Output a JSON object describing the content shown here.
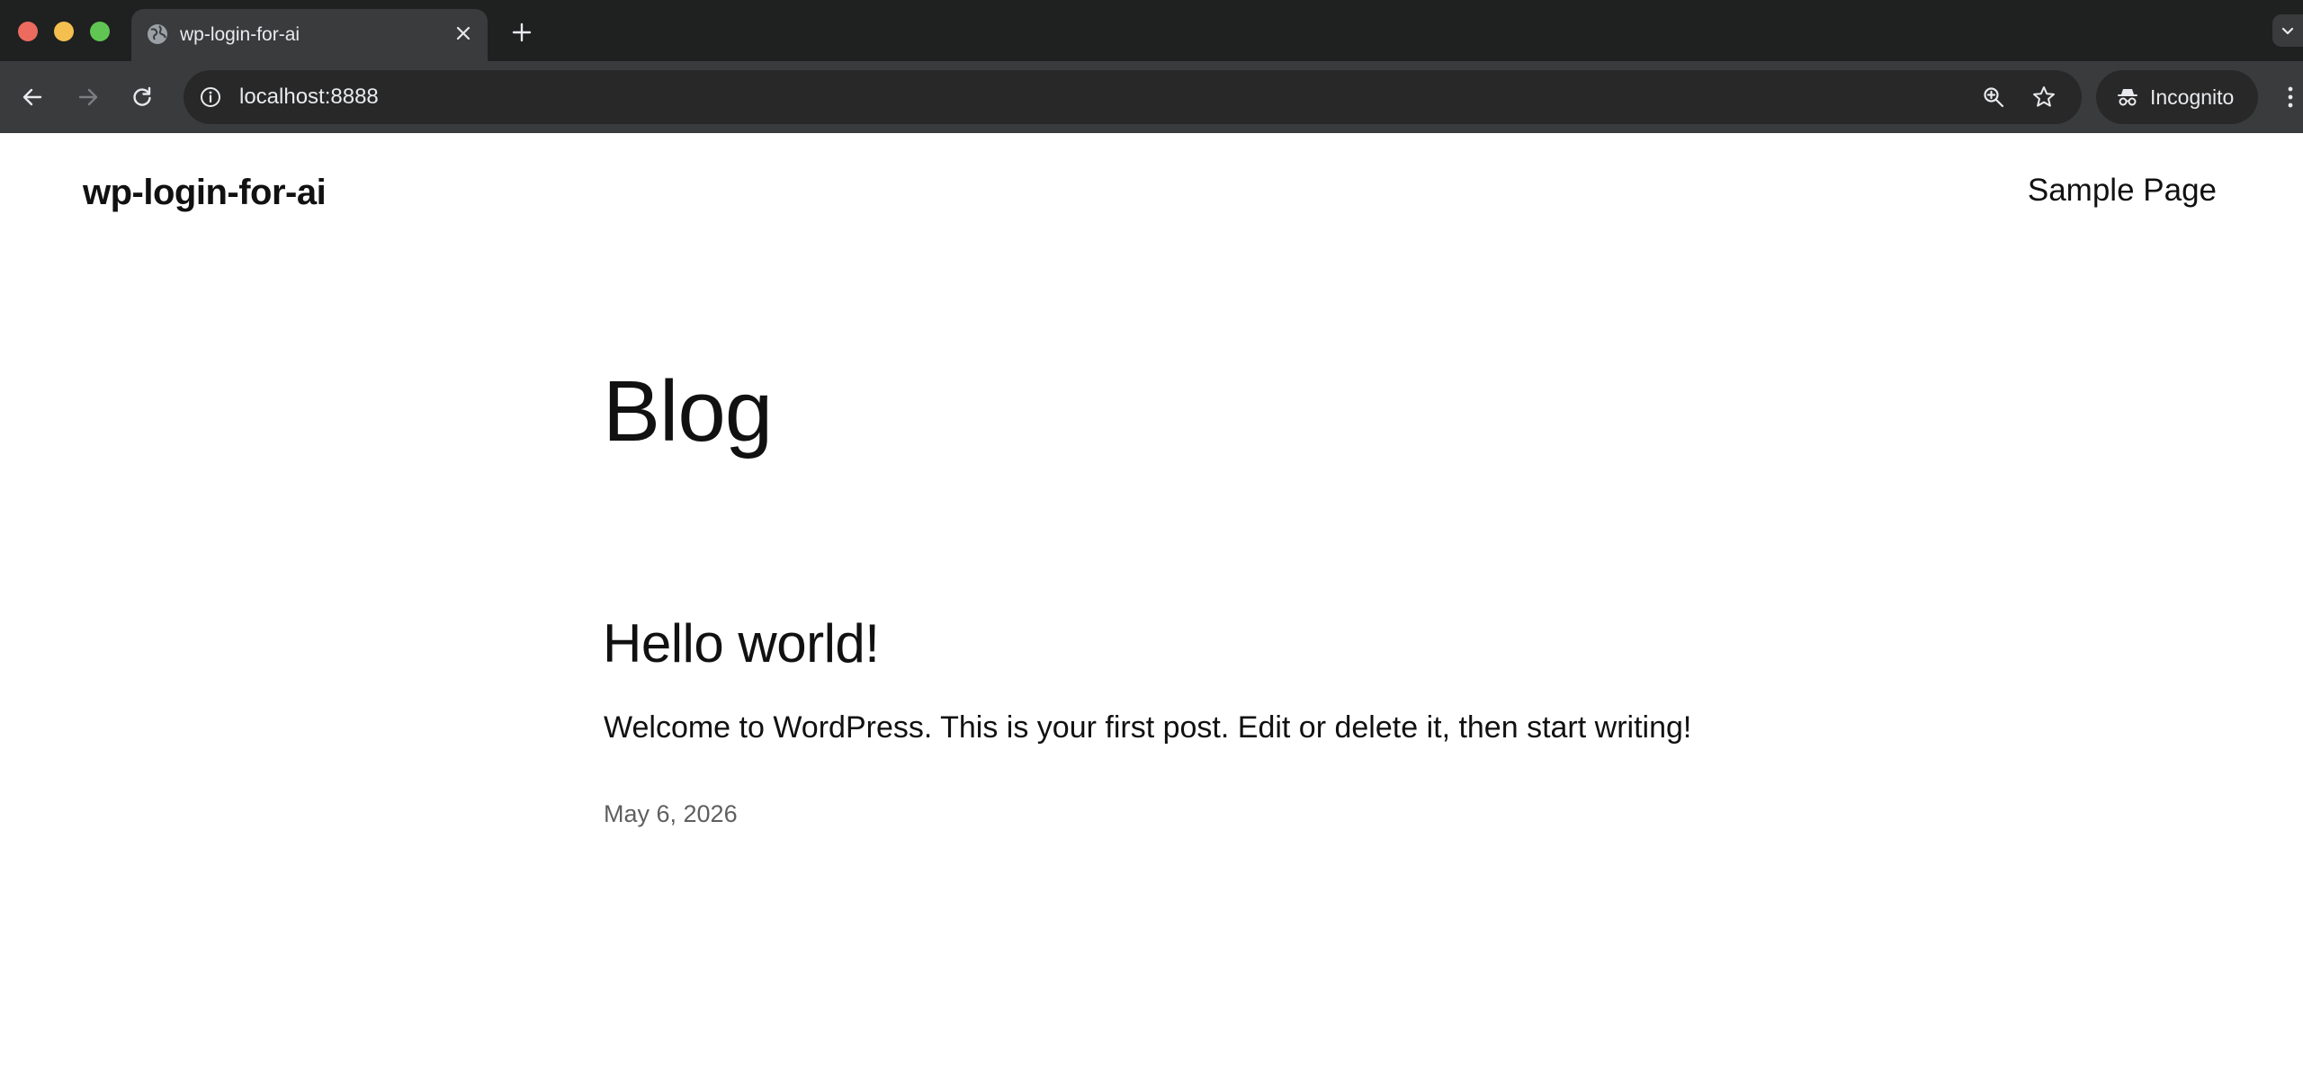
{
  "browser": {
    "tab": {
      "title": "wp-login-for-ai",
      "favicon": "globe-icon"
    },
    "url": "localhost:8888",
    "profile_label": "Incognito",
    "icons": [
      "back-arrow-icon",
      "forward-arrow-icon",
      "reload-icon",
      "info-icon",
      "zoom-icon",
      "star-icon",
      "incognito-icon",
      "kebab-menu-icon",
      "plus-icon",
      "close-icon",
      "chevron-down-icon"
    ],
    "colors": {
      "frame": "#1f2020",
      "toolbar": "#3a3b3c",
      "omnibox": "#282828",
      "close_light": "#ec6a5e",
      "minimize_light": "#f4bf4f",
      "maximize_light": "#61c554"
    }
  },
  "site": {
    "title": "wp-login-for-ai",
    "nav": [
      {
        "label": "Sample Page"
      }
    ]
  },
  "main": {
    "heading": "Blog",
    "posts": [
      {
        "title": "Hello world!",
        "excerpt": "Welcome to WordPress. This is your first post. Edit or delete it, then start writing!",
        "date": "May 6, 2026"
      }
    ]
  }
}
